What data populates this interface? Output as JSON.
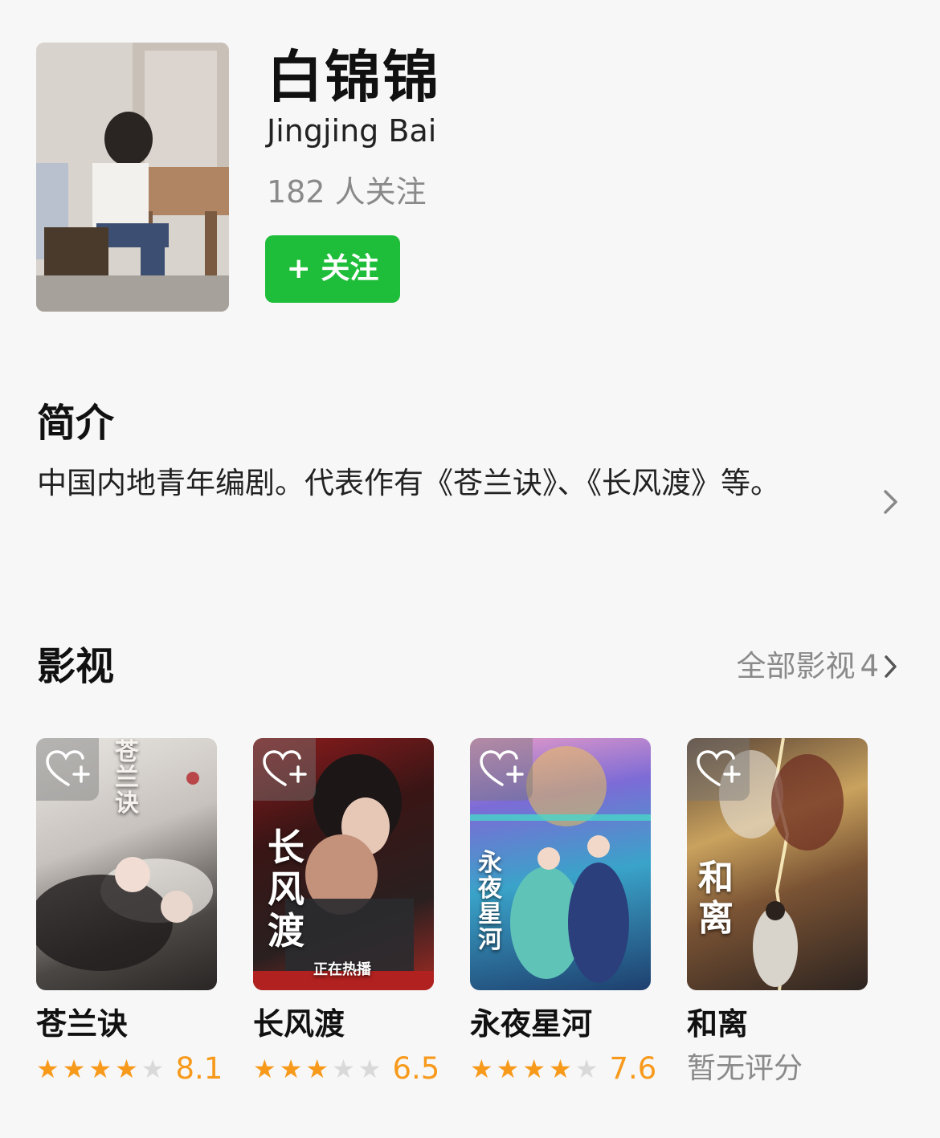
{
  "profile": {
    "name_cn": "白锦锦",
    "name_en": "Jingjing Bai",
    "followers": "182 人关注",
    "follow_button": "+ 关注"
  },
  "intro": {
    "title": "简介",
    "text": "中国内地青年编剧。代表作有《苍兰诀》、《长风渡》等。"
  },
  "works": {
    "title": "影视",
    "all_label": "全部影视",
    "all_count": "4",
    "items": [
      {
        "title": "苍兰诀",
        "rating": 4,
        "score": "8.1",
        "poster_title": "苍兰诀",
        "poster_extra": ""
      },
      {
        "title": "长风渡",
        "rating": 3,
        "score": "6.5",
        "poster_title": "长风渡",
        "poster_extra": "正在热播"
      },
      {
        "title": "永夜星河",
        "rating": 4,
        "score": "7.6",
        "poster_title": "永夜星河",
        "poster_extra": ""
      },
      {
        "title": "和离",
        "rating": 0,
        "score": "",
        "no_score_label": "暂无评分",
        "poster_title": "和离",
        "poster_extra": ""
      }
    ]
  },
  "colors": {
    "accent_green": "#1fbe3a",
    "star_orange": "#f79a1b",
    "muted_gray": "#8a8a8a"
  },
  "icons": {
    "favorite": "heart-plus-icon",
    "chevron": "chevron-right-icon",
    "star": "star-icon"
  }
}
